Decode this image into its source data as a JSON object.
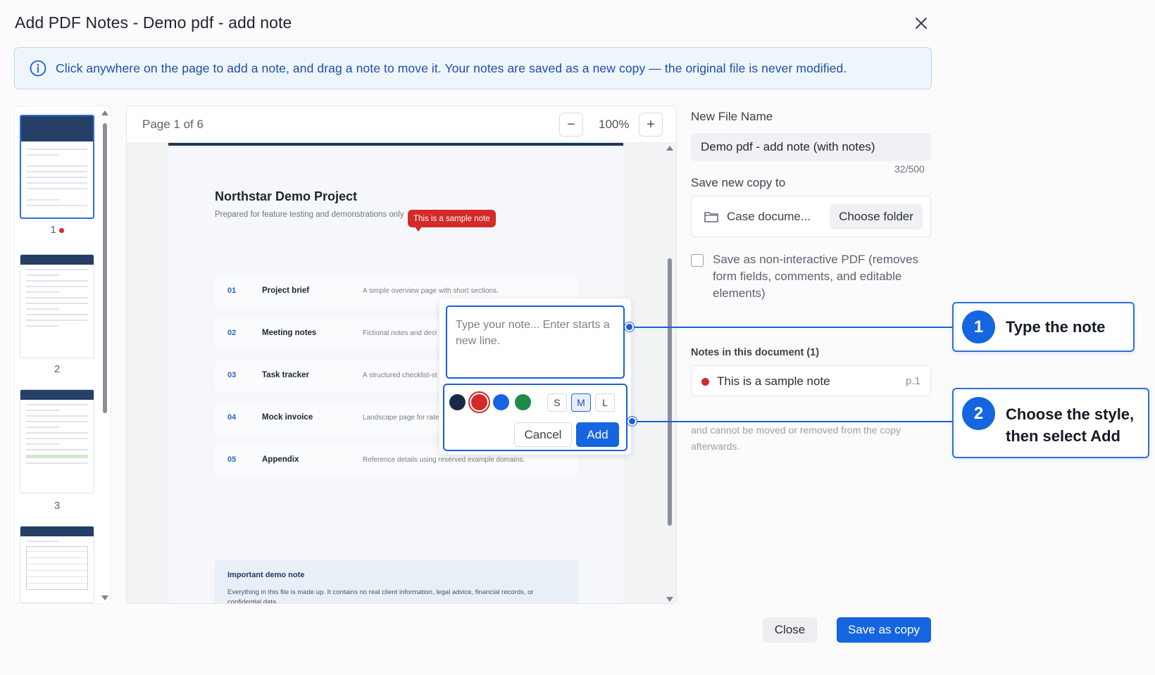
{
  "dialog": {
    "title": "Add PDF Notes - Demo pdf - add note"
  },
  "info": {
    "text": "Click anywhere on the page to add a note, and drag a note to move it. Your notes are saved as a new copy — the original file is never modified."
  },
  "thumbnails": [
    {
      "label": "1",
      "has_note": true
    },
    {
      "label": "2",
      "has_note": false
    },
    {
      "label": "3",
      "has_note": false
    }
  ],
  "viewer": {
    "page_indicator": "Page 1 of 6",
    "zoom_minus": "−",
    "zoom_plus": "+",
    "zoom_level": "100%"
  },
  "document": {
    "title": "Northstar Demo Project",
    "subtitle": "Prepared for feature testing and demonstrations only",
    "rows": [
      {
        "num": "01",
        "name": "Project brief",
        "desc": "A simple overview page with short sections."
      },
      {
        "num": "02",
        "name": "Meeting notes",
        "desc": "Fictional notes and deci"
      },
      {
        "num": "03",
        "name": "Task tracker",
        "desc": "A structured checklist-st"
      },
      {
        "num": "04",
        "name": "Mock invoice",
        "desc": "Landscape page for rate"
      },
      {
        "num": "05",
        "name": "Appendix",
        "desc": "Reference details using reserved example domains."
      }
    ],
    "important_title": "Important demo note",
    "important_body": "Everything in this file is made up. It contains no real client information, legal advice, financial records, or confidential data.",
    "sample_note": "This is a sample note"
  },
  "note_popup": {
    "placeholder": "Type your note... Enter starts a new line.",
    "colors": [
      "#1b2a44",
      "#d42a2a",
      "#1565e0",
      "#1f8a47"
    ],
    "selected_color": "#d42a2a",
    "sizes": [
      "S",
      "M",
      "L"
    ],
    "selected_size": "M",
    "cancel": "Cancel",
    "add": "Add"
  },
  "panel": {
    "file_name_label": "New File Name",
    "file_name": "Demo pdf - add note (with notes)",
    "char_count": "32/500",
    "save_to_label": "Save new copy to",
    "folder": "Case docume...",
    "choose_folder": "Choose folder",
    "non_interactive_label": "Save as non-interactive PDF (removes form fields, comments, and editable elements)",
    "notes_title": "Notes in this document (1)",
    "notes": [
      {
        "text": "This is a sample note",
        "page": "p.1"
      }
    ],
    "footnote": "and cannot be moved or removed from the copy afterwards."
  },
  "callouts": [
    {
      "num": "1",
      "text": "Type the note"
    },
    {
      "num": "2",
      "text": "Choose the style, then select Add"
    }
  ],
  "footer": {
    "close": "Close",
    "save": "Save as copy"
  },
  "colors": {
    "accent": "#1565e0",
    "note_red": "#d42a2a",
    "info_bg": "#eef5fd",
    "info_text": "#1d4fa6"
  }
}
